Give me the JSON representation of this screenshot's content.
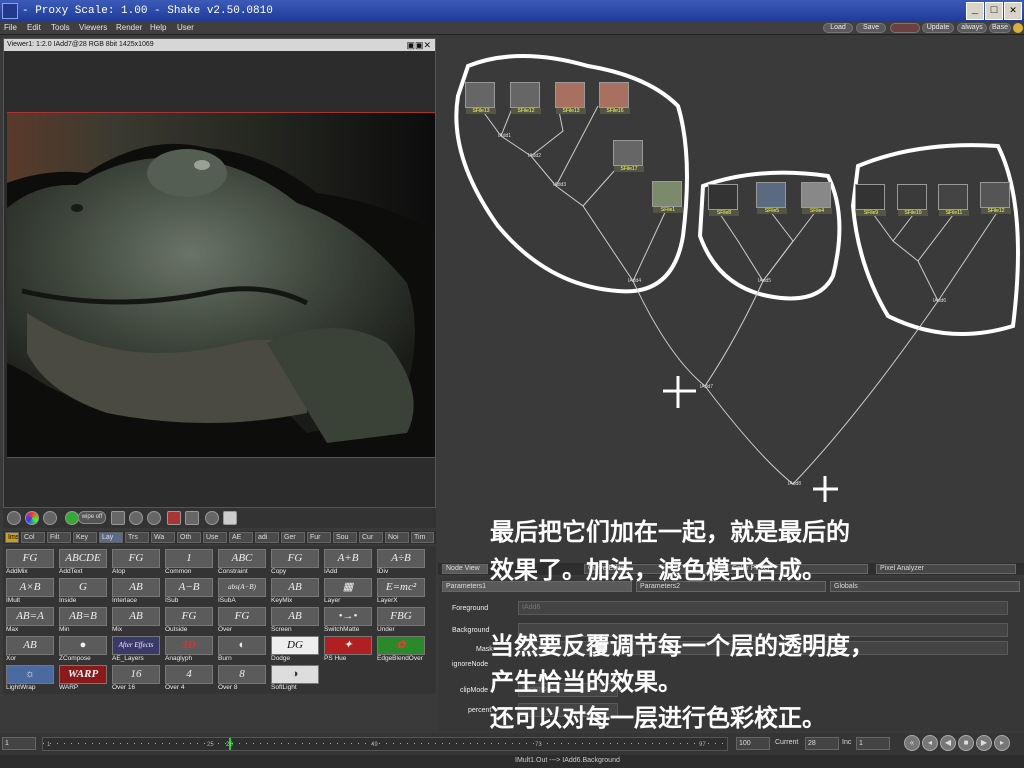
{
  "window": {
    "title": "- Proxy Scale: 1.00 - Shake v2.50.0810"
  },
  "menu": [
    "File",
    "Edit",
    "Tools",
    "Viewers",
    "Render",
    "Help",
    "User"
  ],
  "top_buttons": [
    "Load",
    "Save",
    "Update",
    "always",
    "Base"
  ],
  "viewer": {
    "header": "Viewer1: 1:2.0 IAdd7@28 RGB 8bit 1425x1069",
    "wipe_label": "wipe off"
  },
  "tool_tabs": [
    "Ims",
    "Col",
    "Filt",
    "Key",
    "Lay",
    "Trs",
    "Wa",
    "Oth",
    "Use",
    "AE",
    "adi",
    "Ger",
    "Fur",
    "Sou",
    "Cur",
    "Noi",
    "Tim"
  ],
  "tools": [
    {
      "label": "AddMix",
      "icon": "FG"
    },
    {
      "label": "AddText",
      "icon": "ABCDE"
    },
    {
      "label": "Atop",
      "icon": "FG"
    },
    {
      "label": "Common",
      "icon": "1"
    },
    {
      "label": "Constraint",
      "icon": "ABC"
    },
    {
      "label": "Copy",
      "icon": "FG"
    },
    {
      "label": "IAdd",
      "icon": "A+B"
    },
    {
      "label": "IDiv",
      "icon": "A÷B"
    },
    {
      "label": "IMult",
      "icon": "A×B"
    },
    {
      "label": "Inside",
      "icon": "G"
    },
    {
      "label": "Interlace",
      "icon": "AB"
    },
    {
      "label": "ISub",
      "icon": "A−B"
    },
    {
      "label": "ISubA",
      "icon": "abs(A−B)"
    },
    {
      "label": "KeyMix",
      "icon": "AB"
    },
    {
      "label": "Layer",
      "icon": "▦"
    },
    {
      "label": "LayerX",
      "icon": "E=mc²"
    },
    {
      "label": "Max",
      "icon": "AB=A"
    },
    {
      "label": "Min",
      "icon": "AB=B"
    },
    {
      "label": "Mix",
      "icon": "AB"
    },
    {
      "label": "Outside",
      "icon": "FG"
    },
    {
      "label": "Over",
      "icon": "FG"
    },
    {
      "label": "Screen",
      "icon": "AB"
    },
    {
      "label": "SwitchMatte",
      "icon": "•→•"
    },
    {
      "label": "Under",
      "icon": "FBG"
    },
    {
      "label": "Xor",
      "icon": "AB"
    },
    {
      "label": "ZCompose",
      "icon": "●"
    },
    {
      "label": "AE_Layers",
      "icon": "After Effects"
    },
    {
      "label": "Anaglyph",
      "icon": "3D"
    },
    {
      "label": "Burn",
      "icon": "◐"
    },
    {
      "label": "Dodge",
      "icon": "DG"
    },
    {
      "label": "PS Hue",
      "icon": "✦"
    },
    {
      "label": "EdgeBlendOver",
      "icon": "✿"
    },
    {
      "label": "LightWrap",
      "icon": "☼"
    },
    {
      "label": "WARP",
      "icon": "WARP"
    },
    {
      "label": "Over 16",
      "icon": "16"
    },
    {
      "label": "Over 4",
      "icon": "4"
    },
    {
      "label": "Over 8",
      "icon": "8"
    },
    {
      "label": "SoftLight",
      "icon": "◑"
    }
  ],
  "nodes": {
    "group1": [
      "SFile13",
      "SFile12",
      "SFile13",
      "SFile16",
      "SFile17",
      "SFile1"
    ],
    "group2": [
      "SFile8",
      "SFile5",
      "SFile4"
    ],
    "group3": [
      "SFile9",
      "SFile10",
      "SFile11",
      "SFile12"
    ],
    "joins": [
      "IAdd1",
      "IAdd2",
      "IAdd3",
      "IAdd4",
      "IAdd5",
      "IAdd6",
      "IAdd7",
      "IAdd8"
    ]
  },
  "bottom_tabs": [
    "Node View",
    "Curve Editor",
    "Color Picker",
    "Pixel Analyzer"
  ],
  "params": {
    "tabs": [
      "Parameters1",
      "Parameters2",
      "Globals"
    ],
    "node_name": "IAdd6",
    "rows": [
      "Foreground",
      "Background",
      "Mask",
      "ignoreNode",
      "clipMode",
      "percent"
    ],
    "clipmode_value": "background"
  },
  "overlays": {
    "line1": "最后把它们加在一起，就是最后的",
    "line2": "效果了。加法，滤色模式合成。",
    "line3": "当然要反覆调节每一个层的透明度，",
    "line4": "产生恰当的效果。",
    "line5": "还可以对每一层进行色彩校正。"
  },
  "timeline": {
    "start": "1",
    "ticks": [
      "1",
      "25",
      "49",
      "73",
      "97"
    ],
    "marker": "28",
    "end": "100",
    "current_label": "Current",
    "current": "28",
    "inc_label": "Inc",
    "inc": "1"
  },
  "status": {
    "text": "IMult1.Out  --->  IAdd6.Background"
  }
}
